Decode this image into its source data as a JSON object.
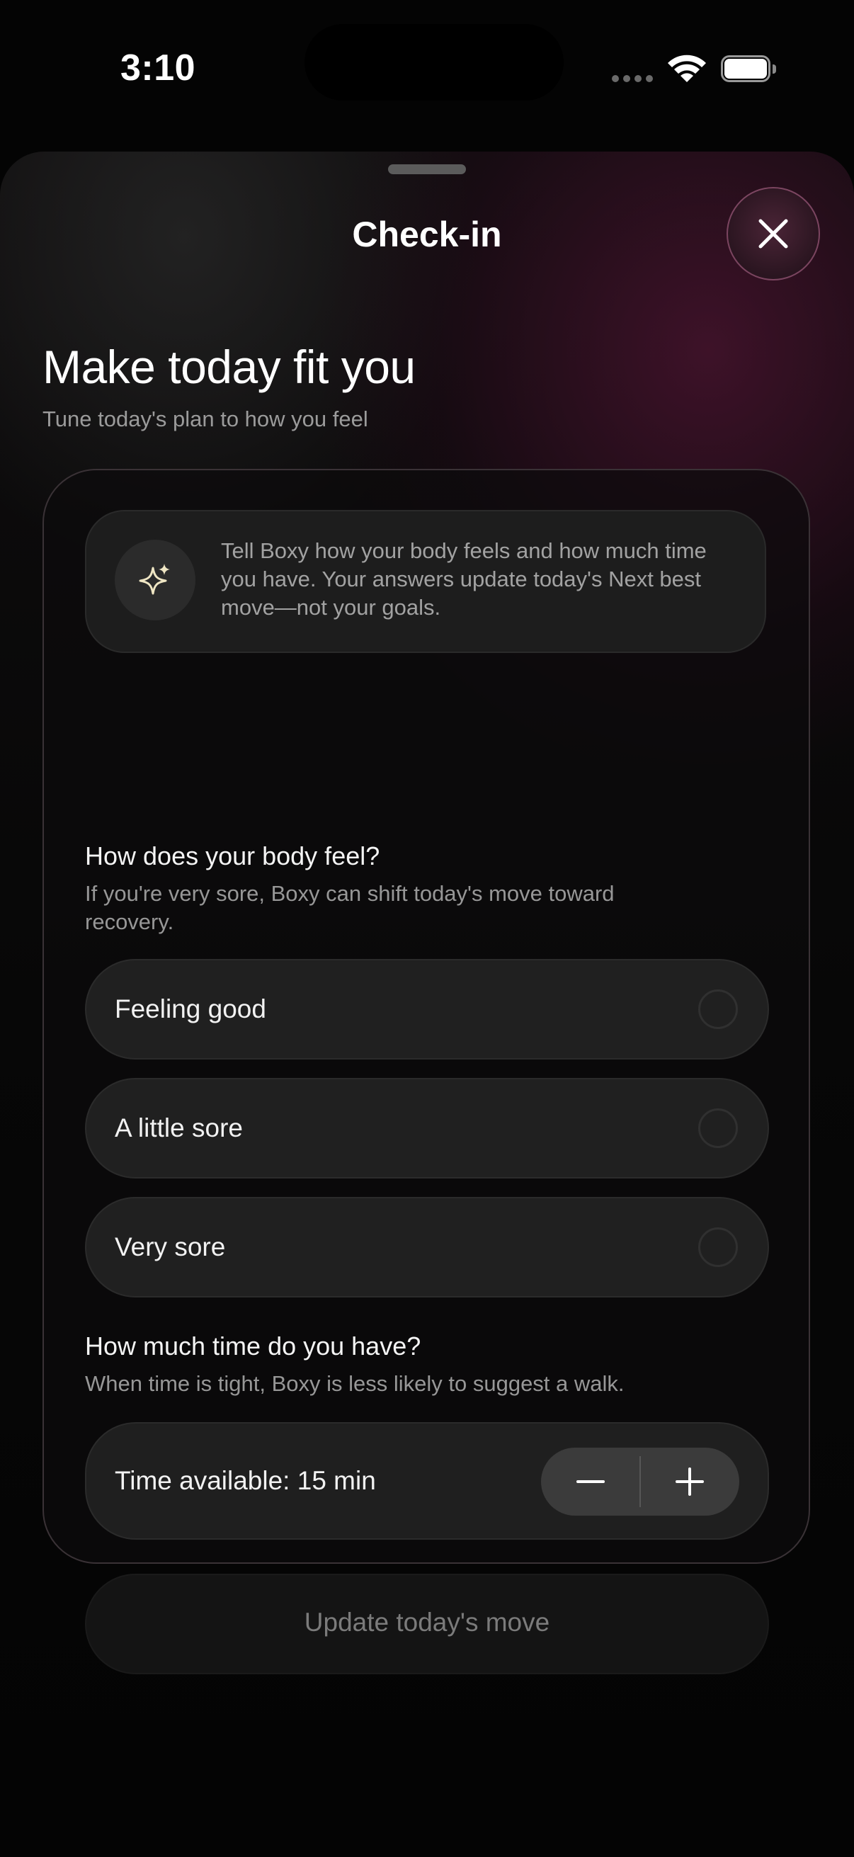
{
  "status_bar": {
    "time": "3:10"
  },
  "sheet": {
    "title": "Check-in",
    "close_icon": "close-icon"
  },
  "header": {
    "title": "Make today fit you",
    "subtitle": "Tune today's plan to how you feel"
  },
  "info": {
    "icon": "sparkle-icon",
    "text": "Tell Boxy how your body feels and how much time you have. Your answers update today's Next best move—not your goals."
  },
  "body_question": {
    "heading": "How does your body feel?",
    "help": "If you're very sore, Boxy can shift today's move toward recovery.",
    "options": [
      {
        "label": "Feeling good",
        "selected": false
      },
      {
        "label": "A little sore",
        "selected": false
      },
      {
        "label": "Very sore",
        "selected": false
      }
    ]
  },
  "time_question": {
    "heading": "How much time do you have?",
    "help": "When time is tight, Boxy is less likely to suggest a walk.",
    "label": "Time available: 15 min",
    "decrement_icon": "minus-icon",
    "increment_icon": "plus-icon"
  },
  "update_button": {
    "label": "Update today's move",
    "enabled": false
  },
  "colors": {
    "background": "#040404",
    "accent_close": "#4a2436",
    "muted_text": "#9b9b9b",
    "sparkle": "#efe6c4"
  }
}
